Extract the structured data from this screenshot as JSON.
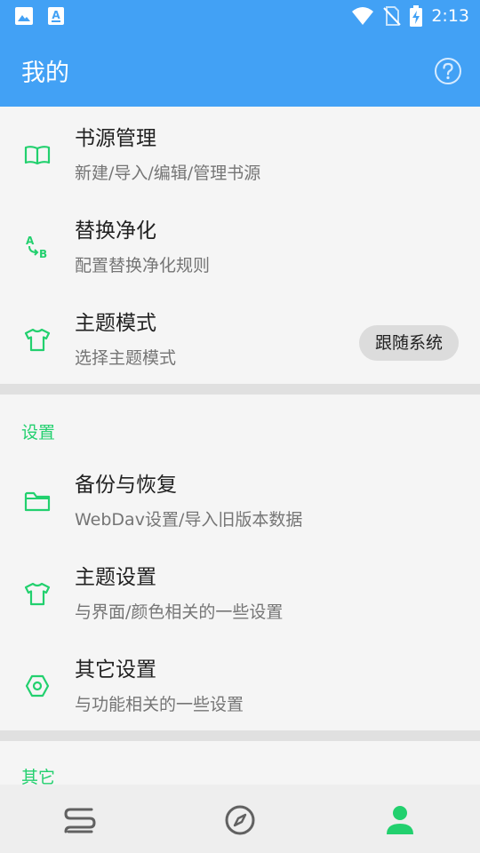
{
  "status_bar": {
    "time": "2:13"
  },
  "app_bar": {
    "title": "我的"
  },
  "top_items": [
    {
      "title": "书源管理",
      "summary": "新建/导入/编辑/管理书源",
      "icon": "book-open-icon"
    },
    {
      "title": "替换净化",
      "summary": "配置替换净化规则",
      "icon": "replace-ab-icon"
    },
    {
      "title": "主题模式",
      "summary": "选择主题模式",
      "icon": "tshirt-icon",
      "value": "跟随系统"
    }
  ],
  "settings_section": {
    "header": "设置",
    "items": [
      {
        "title": "备份与恢复",
        "summary": "WebDav设置/导入旧版本数据",
        "icon": "folder-icon"
      },
      {
        "title": "主题设置",
        "summary": "与界面/颜色相关的一些设置",
        "icon": "tshirt-icon"
      },
      {
        "title": "其它设置",
        "summary": "与功能相关的一些设置",
        "icon": "hex-nut-icon"
      }
    ]
  },
  "other_section": {
    "header": "其它"
  },
  "bottom_nav": [
    {
      "icon": "bookshelf-icon",
      "active": false
    },
    {
      "icon": "compass-icon",
      "active": false
    },
    {
      "icon": "person-icon",
      "active": true
    }
  ],
  "colors": {
    "primary": "#42a1f5",
    "accent": "#22d06e",
    "nav_inactive": "#616161"
  }
}
